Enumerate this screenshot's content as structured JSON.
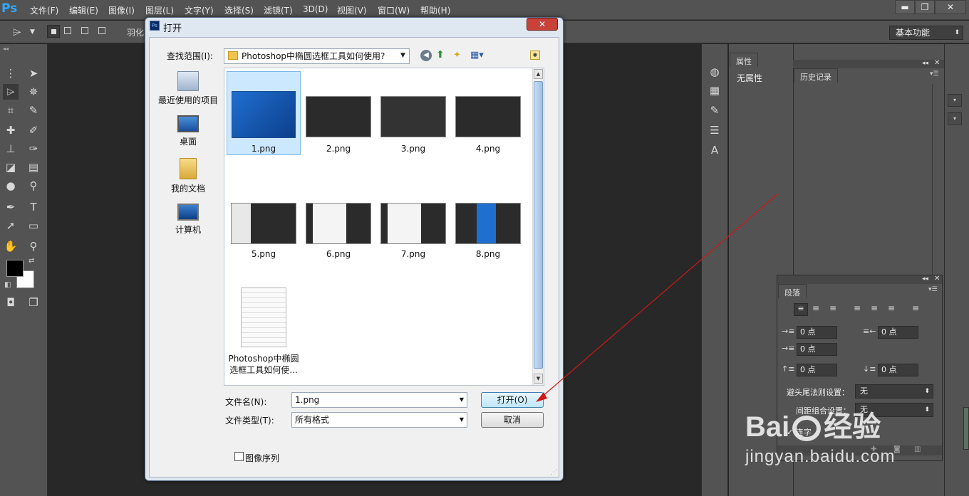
{
  "app": {
    "logo": "Ps",
    "menus": [
      "文件(F)",
      "编辑(E)",
      "图像(I)",
      "图层(L)",
      "文字(Y)",
      "选择(S)",
      "滤镜(T)",
      "3D(D)",
      "视图(V)",
      "窗口(W)",
      "帮助(H)"
    ],
    "window_buttons": [
      "▬",
      "❐",
      "✕"
    ],
    "options_label": "羽化",
    "workspace": "基本功能"
  },
  "panels": {
    "properties_tab": "属性",
    "properties_text": "无属性",
    "history_tab": "历史记录",
    "paragraph_tab": "段落",
    "indent_left": "0 点",
    "indent_right": "0 点",
    "indent_first": "0 点",
    "space_before": "0 点",
    "space_after": "0 点",
    "kinsoku_label": "避头尾法则设置：",
    "kinsoku_value": "无",
    "mojikumi_label": "间距组合设置：",
    "mojikumi_value": "无",
    "hyphenate_label": "连字"
  },
  "dialog": {
    "title": "打开",
    "close": "✕",
    "look_in_label": "查找范围(I):",
    "look_in_value": "Photoshop中椭圆选框工具如何使用?",
    "places": [
      {
        "label": "最近使用的项目",
        "icon": "recent-icon"
      },
      {
        "label": "桌面",
        "icon": "desktop-icon"
      },
      {
        "label": "我的文档",
        "icon": "documents-icon"
      },
      {
        "label": "计算机",
        "icon": "computer-icon"
      }
    ],
    "files": [
      "1.png",
      "2.png",
      "3.png",
      "4.png",
      "5.png",
      "6.png",
      "7.png",
      "8.png"
    ],
    "doc_line1": "Photoshop中椭圆",
    "doc_line2": "选框工具如何使...",
    "filename_label": "文件名(N):",
    "filename_value": "1.png",
    "filetype_label": "文件类型(T):",
    "filetype_value": "所有格式",
    "open_button": "打开(O)",
    "cancel_button": "取消",
    "sequence_label": "图像序列"
  },
  "watermark": {
    "brand_prefix": "Bai",
    "brand_suffix": "经验",
    "url": "jingyan.baidu.com"
  },
  "colors": {
    "ps_blue": "#31a8ff",
    "dialog_bg": "#f0f0f0",
    "selection": "#cce8ff",
    "annotation_arrow": "#d01818"
  }
}
